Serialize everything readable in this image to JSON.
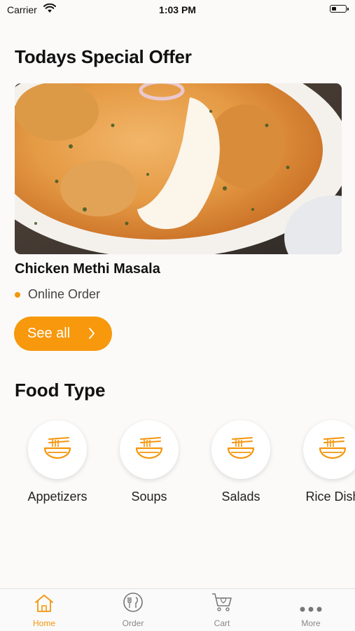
{
  "status_bar": {
    "carrier": "Carrier",
    "time": "1:03 PM",
    "wifi_icon": "wifi-icon",
    "battery_icon": "battery-icon"
  },
  "special": {
    "title": "Todays Special Offer",
    "dish_name": "Chicken Methi Masala",
    "order_type": "Online Order",
    "see_all_label": "See all",
    "hero_image": "food-photo"
  },
  "food_types": {
    "title": "Food Type",
    "items": [
      {
        "label": "Appetizers",
        "icon": "noodle-bowl-icon"
      },
      {
        "label": "Soups",
        "icon": "noodle-bowl-icon"
      },
      {
        "label": "Salads",
        "icon": "noodle-bowl-icon"
      },
      {
        "label": "Rice Dish",
        "icon": "noodle-bowl-icon"
      }
    ]
  },
  "tab_bar": {
    "items": [
      {
        "label": "Home",
        "icon": "home-icon",
        "active": true
      },
      {
        "label": "Order",
        "icon": "fork-knife-icon",
        "active": false
      },
      {
        "label": "Cart",
        "icon": "cart-icon",
        "active": false
      },
      {
        "label": "More",
        "icon": "more-icon",
        "active": false
      }
    ]
  },
  "colors": {
    "accent": "#F7980D",
    "background": "#FBFAF9",
    "inactive_tab": "#888888"
  }
}
